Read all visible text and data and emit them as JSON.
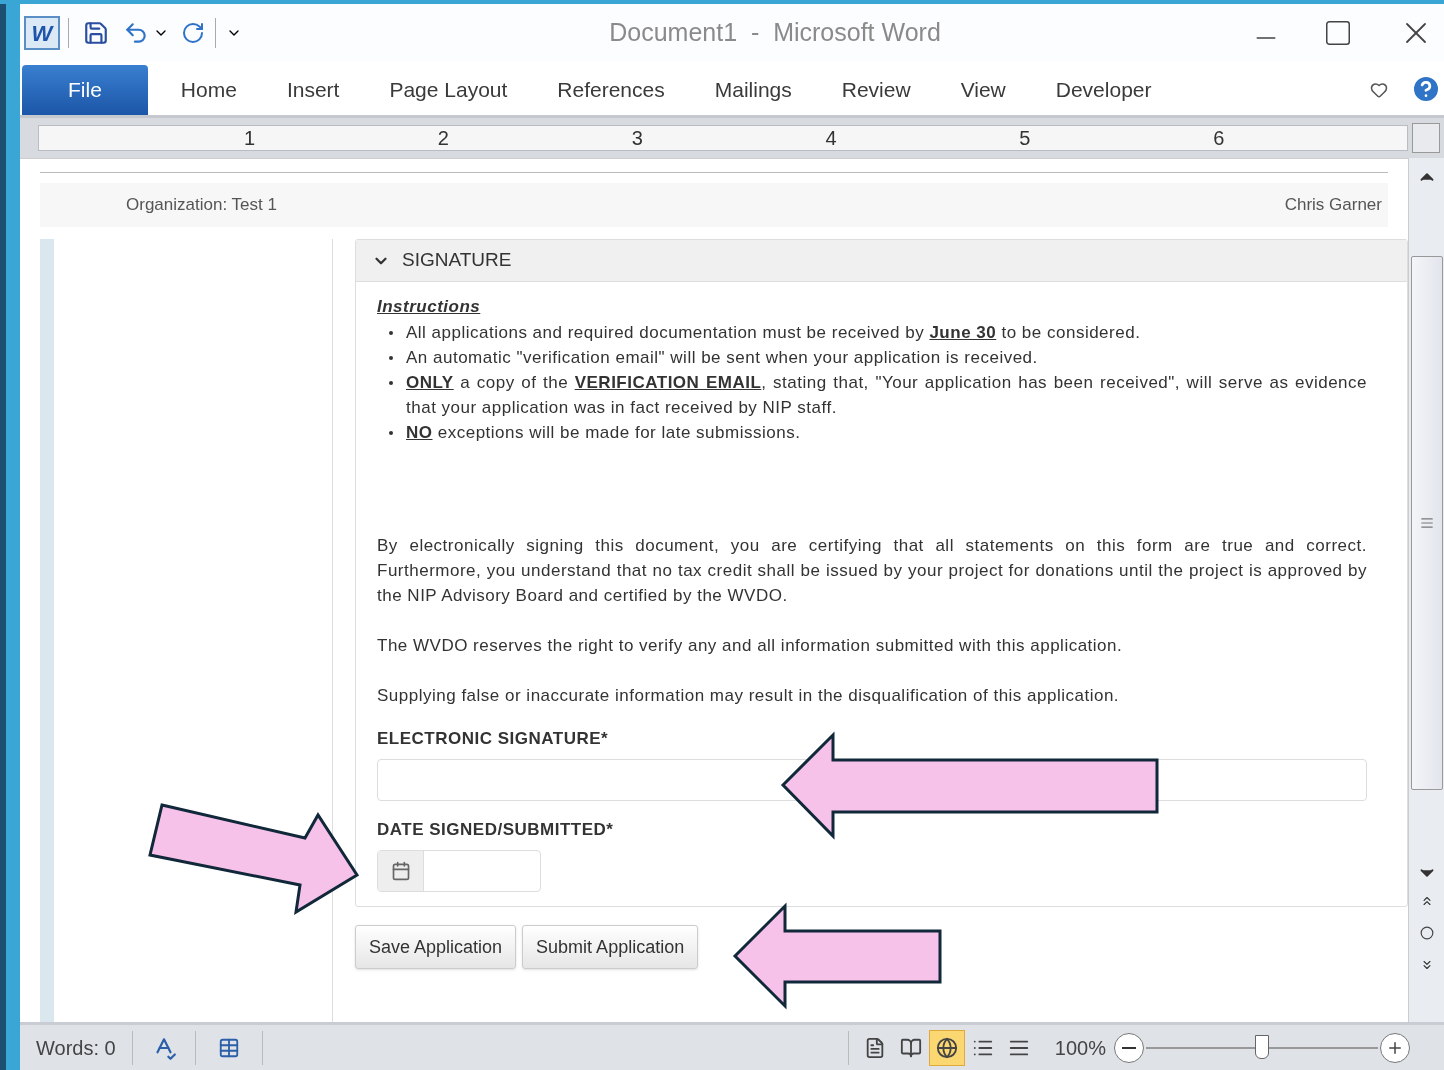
{
  "window": {
    "title": "Document1  -  Microsoft Word",
    "logo_letter": "W"
  },
  "ribbon_tabs": [
    {
      "label": "File",
      "selected": true
    },
    {
      "label": "Home",
      "selected": false
    },
    {
      "label": "Insert",
      "selected": false
    },
    {
      "label": "Page Layout",
      "selected": false
    },
    {
      "label": "References",
      "selected": false
    },
    {
      "label": "Mailings",
      "selected": false
    },
    {
      "label": "Review",
      "selected": false
    },
    {
      "label": "View",
      "selected": false
    },
    {
      "label": "Developer",
      "selected": false
    }
  ],
  "ruler": {
    "numbers": [
      "1",
      "2",
      "3",
      "4",
      "5",
      "6"
    ]
  },
  "page_header": {
    "organization": "Organization: Test 1",
    "user": "Chris Garner"
  },
  "signature_section": {
    "title": "SIGNATURE",
    "expanded": true,
    "instructions_heading": "Instructions",
    "instructions": [
      "All applications and required documentation must be received by **June 30** to be considered.",
      "An automatic \"verification email\" will be sent when your application is received.",
      "**ONLY** a copy of the **VERIFICATION EMAIL**, stating that, \"Your application has been received\", will serve as evidence that your application was in fact received by NIP staff.",
      "**NO** exceptions will be made for late submissions."
    ],
    "paragraphs": [
      "By electronically signing this document, you are certifying that all statements on this form are true and correct. Furthermore, you understand that no tax credit shall be issued by your project for donations until the project is approved by the NIP Advisory Board and certified by the WVDO.",
      "The WVDO reserves the right to verify any and all information submitted with this application.",
      "Supplying false or inaccurate information may result in the disqualification of this application."
    ],
    "signature_label": "ELECTRONIC SIGNATURE*",
    "date_label": "DATE SIGNED/SUBMITTED*"
  },
  "buttons": [
    "Save Application",
    "Submit Application"
  ],
  "status_bar": {
    "words": "Words: 0",
    "view_buttons": [
      {
        "kind": "print",
        "selected": false
      },
      {
        "kind": "reading",
        "selected": false
      },
      {
        "kind": "web",
        "selected": true
      },
      {
        "kind": "outline",
        "selected": false
      },
      {
        "kind": "draft",
        "selected": false
      }
    ],
    "zoom": "100%",
    "zoom_level": {
      "level": 0.5
    }
  }
}
